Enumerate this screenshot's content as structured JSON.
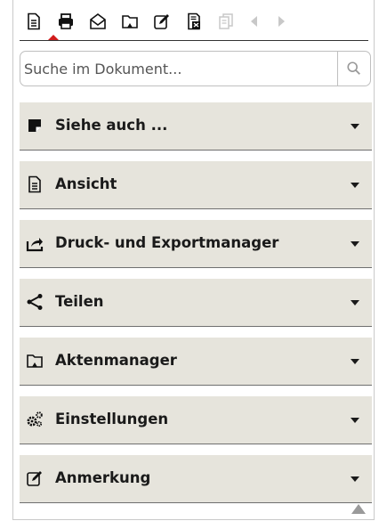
{
  "toolbar": {
    "icons": [
      {
        "name": "document-icon",
        "active": true
      },
      {
        "name": "print-icon"
      },
      {
        "name": "mail-icon"
      },
      {
        "name": "folder-icon"
      },
      {
        "name": "edit-icon"
      },
      {
        "name": "document-excel-icon"
      },
      {
        "name": "copy-icon",
        "disabled": true
      },
      {
        "name": "previous-icon",
        "disabled": true
      },
      {
        "name": "next-icon",
        "disabled": true
      }
    ],
    "active_color": "#d11c1c"
  },
  "search": {
    "placeholder": "Suche im Dokument...",
    "value": ""
  },
  "accordion": {
    "items": [
      {
        "label": "Siehe auch ...",
        "icon": "note-icon"
      },
      {
        "label": "Ansicht",
        "icon": "document-icon"
      },
      {
        "label": "Druck- und Exportmanager",
        "icon": "export-icon"
      },
      {
        "label": "Teilen",
        "icon": "share-icon"
      },
      {
        "label": "Aktenmanager",
        "icon": "folder-icon"
      },
      {
        "label": "Einstellungen",
        "icon": "gears-icon"
      },
      {
        "label": "Anmerkung",
        "icon": "edit-icon"
      }
    ],
    "background": "#e6e4dc"
  }
}
